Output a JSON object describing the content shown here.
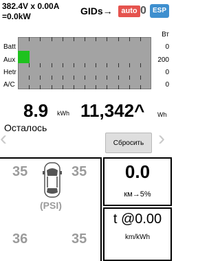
{
  "header": {
    "line1": "382.4V x 0.00A",
    "line2": "=0.0kW",
    "gids_label": "GIDs→",
    "gids_badge": "auto",
    "gids_logo_num": "0",
    "gids_logo_icon": "ESP"
  },
  "bars": {
    "unit_label": "Вт",
    "rows": [
      {
        "label": "Batt",
        "value": "0"
      },
      {
        "label": "Aux",
        "value": "200"
      },
      {
        "label": "Hetr",
        "value": "0"
      },
      {
        "label": "A/C",
        "value": "0"
      }
    ],
    "aux_level": 0.09,
    "fill_color": "#1ec21e"
  },
  "energy": {
    "kwh_value": "8.9",
    "kwh_unit": "kWh",
    "wh_value": "11,342^",
    "wh_unit": "Wh"
  },
  "remaining_label": "Осталось",
  "reset_label": "Сбросить",
  "tires": {
    "front_left": "35",
    "front_right": "35",
    "rear_left": "36",
    "rear_right": "35",
    "unit": "(PSI)"
  },
  "stats": {
    "distance_value": "0.0",
    "distance_unit": "км→5%",
    "efficiency_value": "t @0.00",
    "efficiency_unit": "km/kWh"
  }
}
